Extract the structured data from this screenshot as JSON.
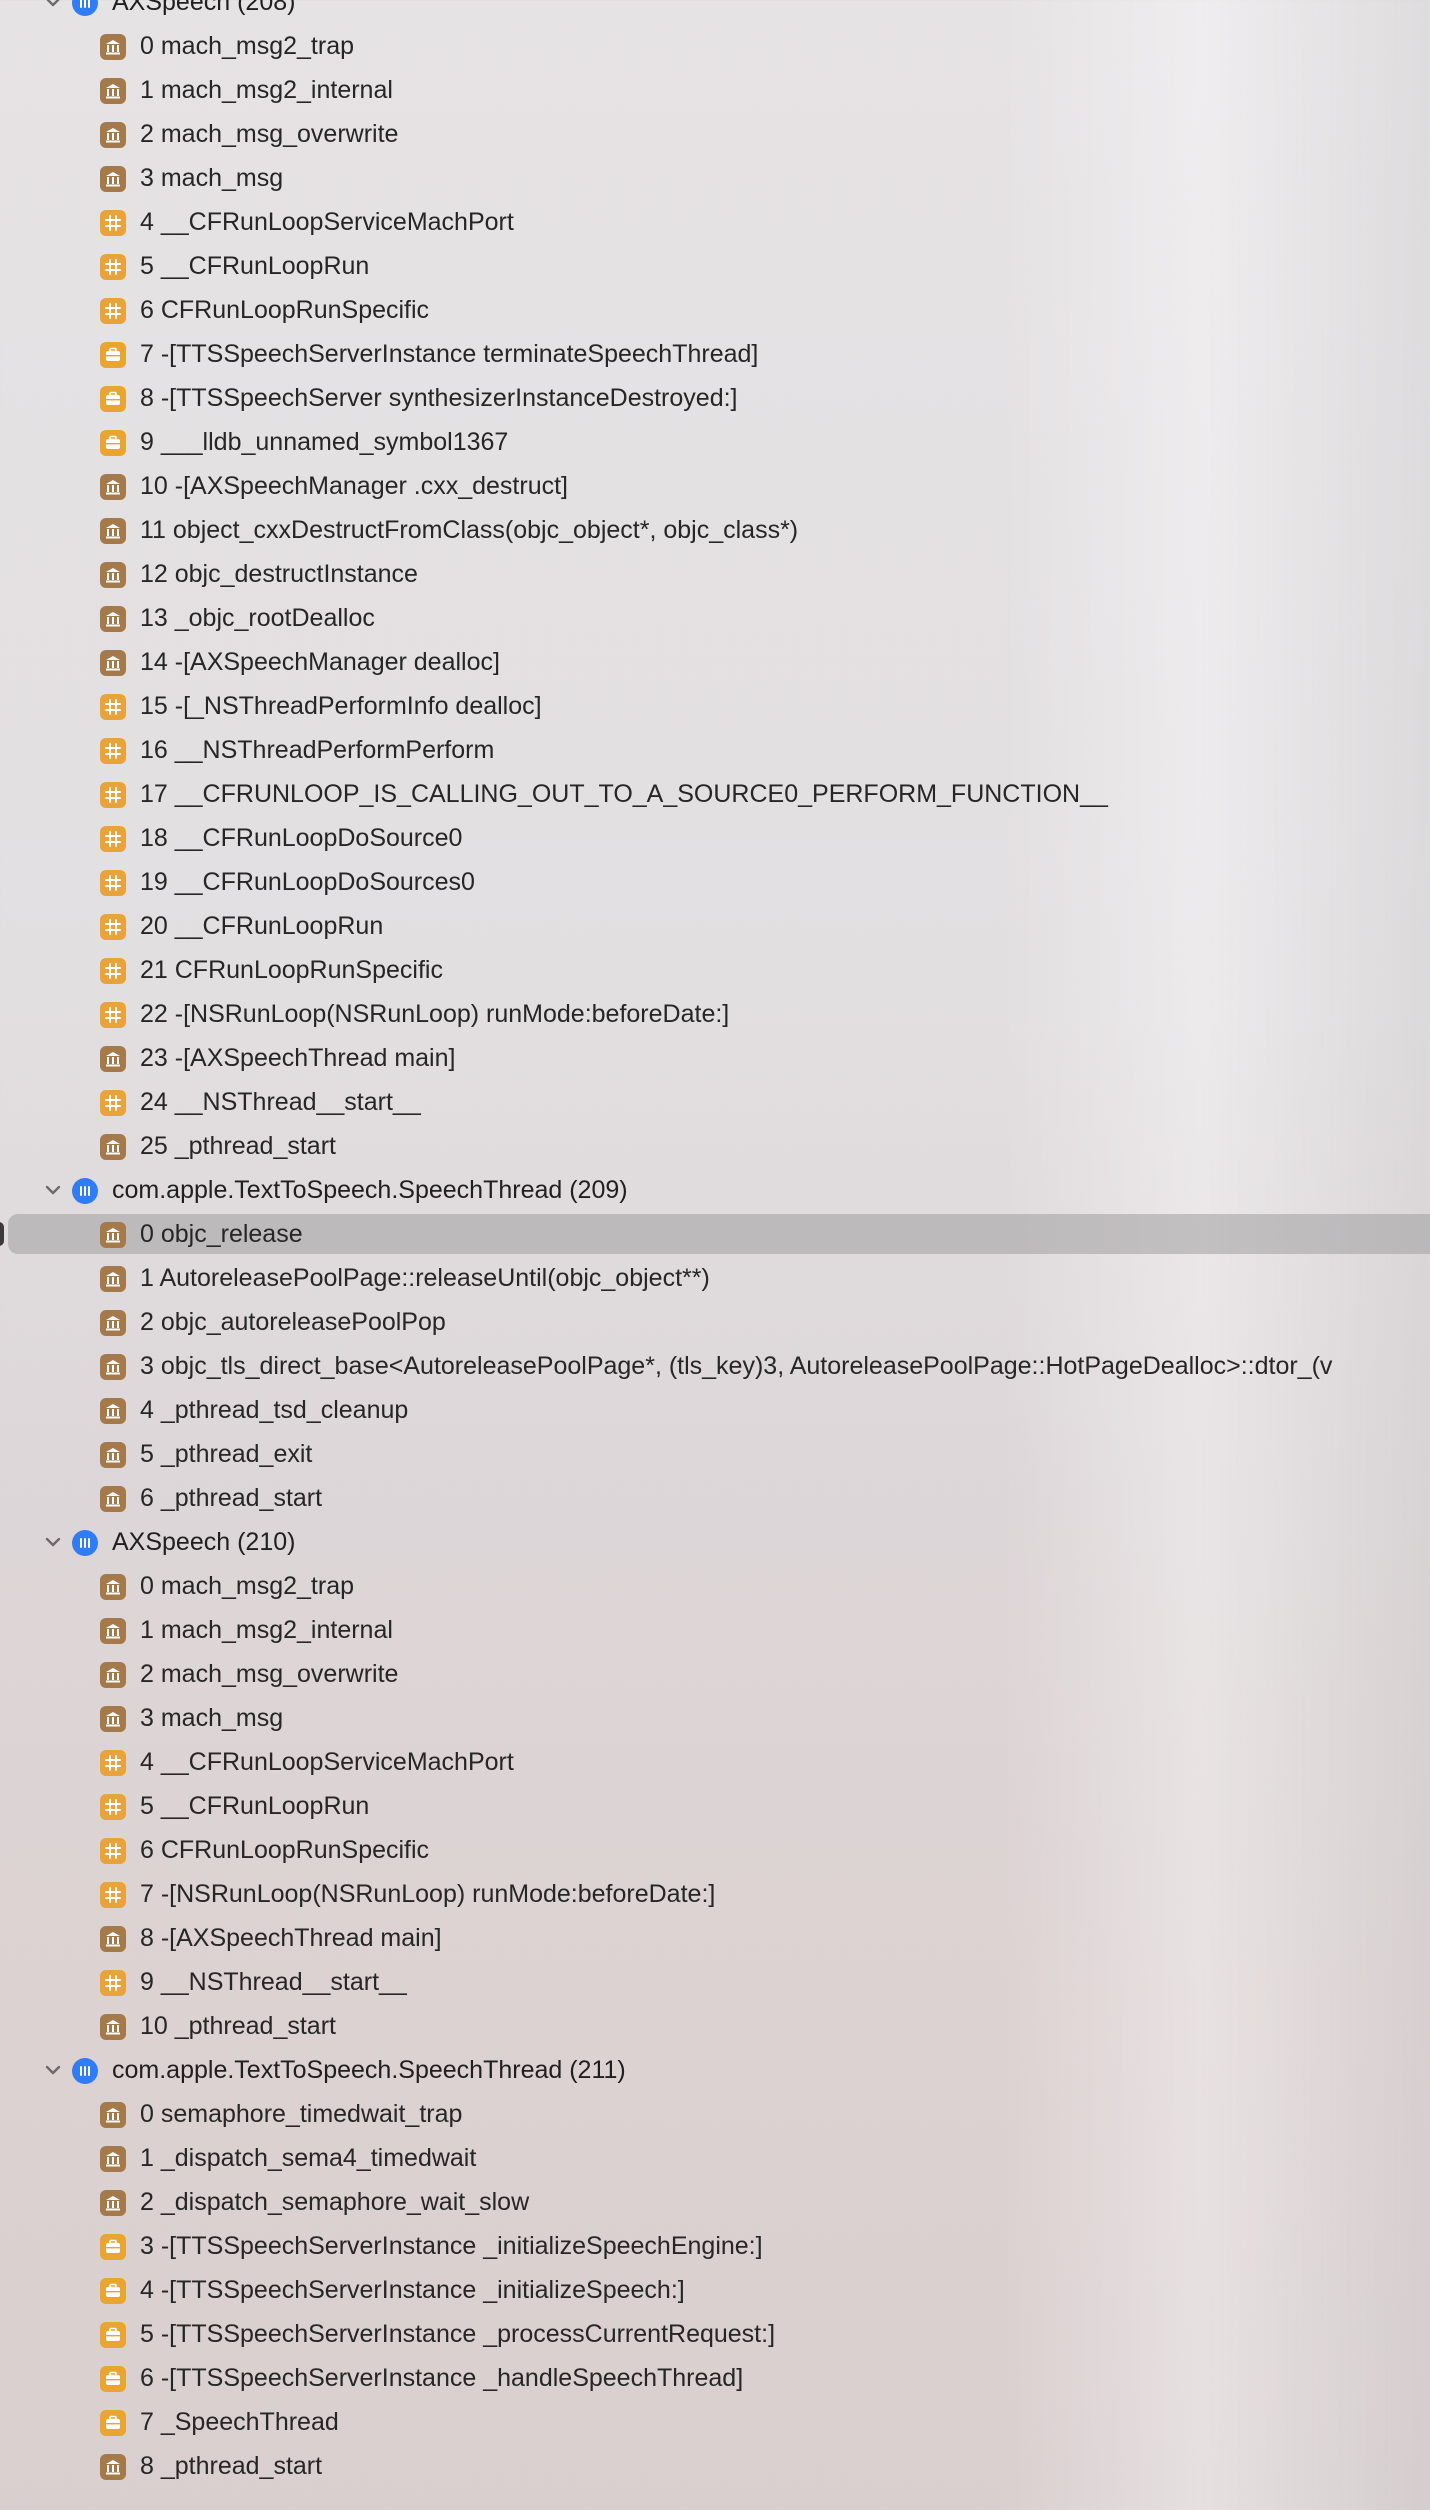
{
  "threads": [
    {
      "label": "AXSpeech (208)",
      "frames": [
        {
          "text": "0 mach_msg2_trap",
          "icon": "lib"
        },
        {
          "text": "1 mach_msg2_internal",
          "icon": "lib"
        },
        {
          "text": "2 mach_msg_overwrite",
          "icon": "lib"
        },
        {
          "text": "3 mach_msg",
          "icon": "lib"
        },
        {
          "text": "4 __CFRunLoopServiceMachPort",
          "icon": "cf"
        },
        {
          "text": "5 __CFRunLoopRun",
          "icon": "cf"
        },
        {
          "text": "6 CFRunLoopRunSpecific",
          "icon": "cf"
        },
        {
          "text": "7 -[TTSSpeechServerInstance terminateSpeechThread]",
          "icon": "tts"
        },
        {
          "text": "8 -[TTSSpeechServer synthesizerInstanceDestroyed:]",
          "icon": "tts"
        },
        {
          "text": "9 ___lldb_unnamed_symbol1367",
          "icon": "tts"
        },
        {
          "text": "10 -[AXSpeechManager .cxx_destruct]",
          "icon": "lib"
        },
        {
          "text": "11 object_cxxDestructFromClass(objc_object*, objc_class*)",
          "icon": "lib"
        },
        {
          "text": "12 objc_destructInstance",
          "icon": "lib"
        },
        {
          "text": "13 _objc_rootDealloc",
          "icon": "lib"
        },
        {
          "text": "14 -[AXSpeechManager dealloc]",
          "icon": "lib"
        },
        {
          "text": "15 -[_NSThreadPerformInfo dealloc]",
          "icon": "cf"
        },
        {
          "text": "16 __NSThreadPerformPerform",
          "icon": "cf"
        },
        {
          "text": "17 __CFRUNLOOP_IS_CALLING_OUT_TO_A_SOURCE0_PERFORM_FUNCTION__",
          "icon": "cf"
        },
        {
          "text": "18 __CFRunLoopDoSource0",
          "icon": "cf"
        },
        {
          "text": "19 __CFRunLoopDoSources0",
          "icon": "cf"
        },
        {
          "text": "20 __CFRunLoopRun",
          "icon": "cf"
        },
        {
          "text": "21 CFRunLoopRunSpecific",
          "icon": "cf"
        },
        {
          "text": "22 -[NSRunLoop(NSRunLoop) runMode:beforeDate:]",
          "icon": "cf"
        },
        {
          "text": "23 -[AXSpeechThread main]",
          "icon": "lib"
        },
        {
          "text": "24 __NSThread__start__",
          "icon": "cf"
        },
        {
          "text": "25 _pthread_start",
          "icon": "lib"
        }
      ]
    },
    {
      "label": "com.apple.TextToSpeech.SpeechThread (209)",
      "frames": [
        {
          "text": "0 objc_release",
          "icon": "lib",
          "selected": true
        },
        {
          "text": "1 AutoreleasePoolPage::releaseUntil(objc_object**)",
          "icon": "lib"
        },
        {
          "text": "2 objc_autoreleasePoolPop",
          "icon": "lib"
        },
        {
          "text": "3 objc_tls_direct_base<AutoreleasePoolPage*, (tls_key)3, AutoreleasePoolPage::HotPageDealloc>::dtor_(v",
          "icon": "lib"
        },
        {
          "text": "4 _pthread_tsd_cleanup",
          "icon": "lib"
        },
        {
          "text": "5 _pthread_exit",
          "icon": "lib"
        },
        {
          "text": "6 _pthread_start",
          "icon": "lib"
        }
      ]
    },
    {
      "label": "AXSpeech (210)",
      "frames": [
        {
          "text": "0 mach_msg2_trap",
          "icon": "lib"
        },
        {
          "text": "1 mach_msg2_internal",
          "icon": "lib"
        },
        {
          "text": "2 mach_msg_overwrite",
          "icon": "lib"
        },
        {
          "text": "3 mach_msg",
          "icon": "lib"
        },
        {
          "text": "4 __CFRunLoopServiceMachPort",
          "icon": "cf"
        },
        {
          "text": "5 __CFRunLoopRun",
          "icon": "cf"
        },
        {
          "text": "6 CFRunLoopRunSpecific",
          "icon": "cf"
        },
        {
          "text": "7 -[NSRunLoop(NSRunLoop) runMode:beforeDate:]",
          "icon": "cf"
        },
        {
          "text": "8 -[AXSpeechThread main]",
          "icon": "lib"
        },
        {
          "text": "9 __NSThread__start__",
          "icon": "cf"
        },
        {
          "text": "10 _pthread_start",
          "icon": "lib"
        }
      ]
    },
    {
      "label": "com.apple.TextToSpeech.SpeechThread (211)",
      "frames": [
        {
          "text": "0 semaphore_timedwait_trap",
          "icon": "lib"
        },
        {
          "text": "1 _dispatch_sema4_timedwait",
          "icon": "lib"
        },
        {
          "text": "2 _dispatch_semaphore_wait_slow",
          "icon": "lib"
        },
        {
          "text": "3 -[TTSSpeechServerInstance _initializeSpeechEngine:]",
          "icon": "tts"
        },
        {
          "text": "4 -[TTSSpeechServerInstance _initializeSpeech:]",
          "icon": "tts"
        },
        {
          "text": "5 -[TTSSpeechServerInstance _processCurrentRequest:]",
          "icon": "tts"
        },
        {
          "text": "6 -[TTSSpeechServerInstance _handleSpeechThread]",
          "icon": "tts"
        },
        {
          "text": "7 _SpeechThread",
          "icon": "tts"
        },
        {
          "text": "8 _pthread_start",
          "icon": "lib"
        }
      ]
    }
  ],
  "colors": {
    "thread_icon": "#2f7cf6",
    "lib_icon": "#a57a4a",
    "cf_icon": "#eaa33a",
    "tts_icon": "#e9a530"
  }
}
